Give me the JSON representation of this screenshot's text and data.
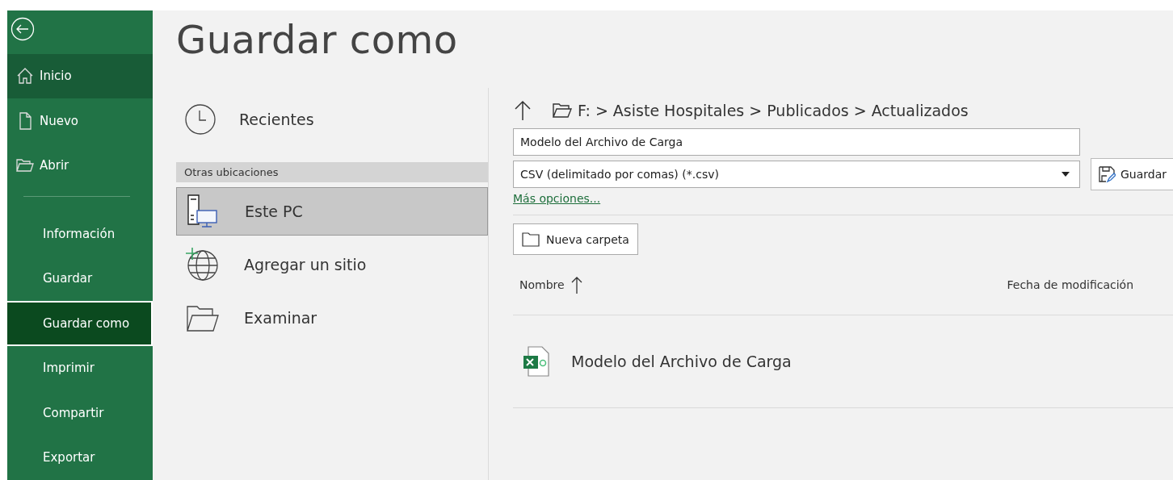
{
  "sidebar": {
    "top_items": [
      {
        "label": "Inicio",
        "kind": "home",
        "selected": false,
        "highlighted": true
      },
      {
        "label": "Nuevo",
        "kind": "new",
        "selected": false,
        "highlighted": false
      },
      {
        "label": "Abrir",
        "kind": "open",
        "selected": false,
        "highlighted": false
      }
    ],
    "items": [
      {
        "label": "Información",
        "selected": false
      },
      {
        "label": "Guardar",
        "selected": false
      },
      {
        "label": "Guardar como",
        "selected": true
      },
      {
        "label": "Imprimir",
        "selected": false
      },
      {
        "label": "Compartir",
        "selected": false
      },
      {
        "label": "Exportar",
        "selected": false
      }
    ]
  },
  "title": "Guardar como",
  "recent": {
    "label": "Recientes"
  },
  "section_header": "Otras ubicaciones",
  "locations": [
    {
      "label": "Este PC",
      "kind": "pc",
      "selected": true
    },
    {
      "label": "Agregar un sitio",
      "kind": "globe",
      "selected": false
    },
    {
      "label": "Examinar",
      "kind": "folder",
      "selected": false
    }
  ],
  "path": "F: > Asiste Hospitales > Publicados > Actualizados",
  "file_name": {
    "value": "Modelo del Archivo de Carga"
  },
  "file_type": {
    "value": "CSV (delimitado por comas) (*.csv)"
  },
  "save_button": "Guardar",
  "more_options_link": "Más opciones...",
  "new_folder_button": "Nueva carpeta",
  "columns": [
    "Nombre",
    "Fecha de modificación"
  ],
  "files": [
    {
      "name": "Modelo del Archivo de Carga",
      "kind": "excel"
    }
  ]
}
